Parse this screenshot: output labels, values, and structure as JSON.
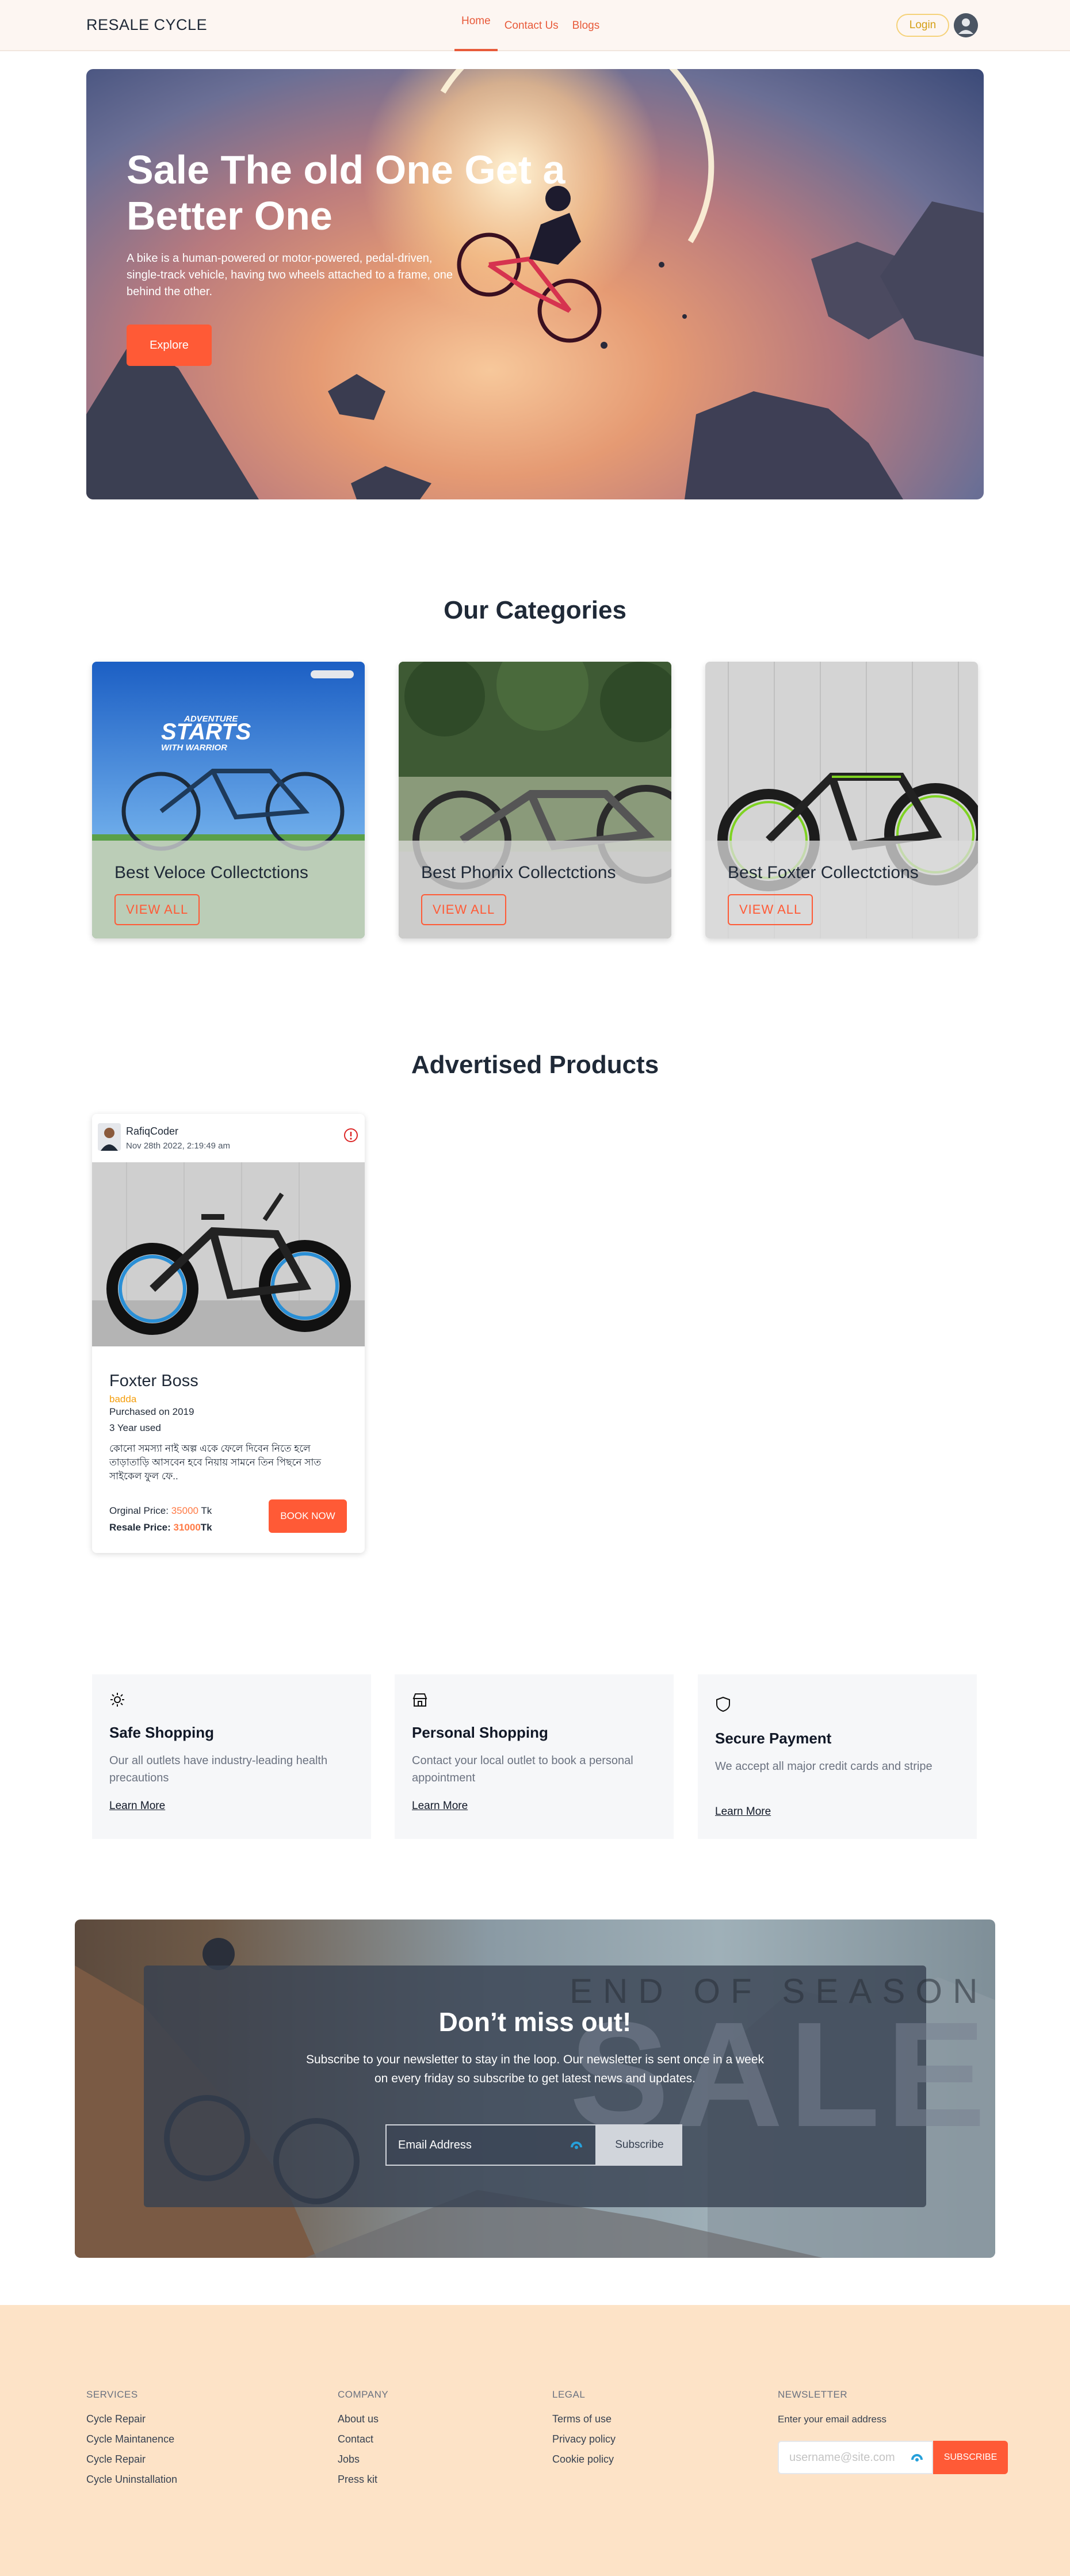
{
  "nav": {
    "brand": "RESALE CYCLE",
    "links": [
      "Home",
      "Contact Us",
      "Blogs"
    ],
    "login": "Login"
  },
  "hero": {
    "title": "Sale The old One Get a Better One",
    "description": "A bike is a human-powered or motor-powered, pedal-driven, single-track vehicle, having two wheels attached to a frame, one behind the other.",
    "button": "Explore"
  },
  "categories": {
    "title": "Our Categories",
    "items": [
      {
        "name": "Best Veloce Collectctions",
        "button": "VIEW ALL",
        "image_text": "ADVENTURE STARTS WITH WARRIOR"
      },
      {
        "name": "Best Phonix Collectctions",
        "button": "VIEW ALL"
      },
      {
        "name": "Best Foxter Collectctions",
        "button": "VIEW ALL"
      }
    ]
  },
  "advertised": {
    "title": "Advertised Products",
    "product": {
      "seller": "RafiqCoder",
      "date": "Nov 28th 2022, 2:19:49 am",
      "name": "Foxter Boss",
      "location": "badda",
      "purchased": "Purchased on 2019",
      "used": "3 Year used",
      "description": "কোনো সমস্যা নাই অল্প একে ফেলে দিবেন নিতে হলে তাড়াতাড়ি আসবেন হবে নিয়ায় সামনে তিন পিছনে সাত সাইকেল ফুল ফে..",
      "original_label": "Orginal Price: ",
      "original_price": "35000",
      "original_unit": " Tk",
      "resale_label": "Resale Price: ",
      "resale_price": "31000",
      "resale_unit": "Tk",
      "button": "BOOK NOW"
    }
  },
  "features": [
    {
      "icon": "sun-icon",
      "title": "Safe Shopping",
      "text": "Our all outlets have industry-leading health precautions",
      "link": "Learn More"
    },
    {
      "icon": "store-icon",
      "title": "Personal Shopping",
      "text": "Contact your local outlet to book a personal appointment",
      "link": "Learn More"
    },
    {
      "icon": "shield-icon",
      "title": "Secure Payment",
      "text": "We accept all major credit cards and stripe",
      "link": "Learn More"
    }
  ],
  "newsletter_banner": {
    "title": "Don’t miss out!",
    "text": "Subscribe to your newsletter to stay in the loop. Our newsletter is sent once in a week on every friday so subscribe to get latest news and updates.",
    "input_placeholder": "Email Address",
    "button": "Subscribe",
    "bg_text_top": "END OF SEASON",
    "bg_text_big": "SALE"
  },
  "footer": {
    "services": {
      "title": "SERVICES",
      "links": [
        "Cycle Repair",
        "Cycle Maintanence",
        "Cycle Repair",
        "Cycle Uninstallation"
      ]
    },
    "company": {
      "title": "COMPANY",
      "links": [
        "About us",
        "Contact",
        "Jobs",
        "Press kit"
      ]
    },
    "legal": {
      "title": "LEGAL",
      "links": [
        "Terms of use",
        "Privacy policy",
        "Cookie policy"
      ]
    },
    "newsletter": {
      "title": "NEWSLETTER",
      "label": "Enter your email address",
      "placeholder": "username@site.com",
      "button": "SUBSCRIBE"
    }
  },
  "colors": {
    "accent": "#ff5a36",
    "navbar_bg": "#fdf6f2",
    "footer_bg": "#fde3c7"
  }
}
